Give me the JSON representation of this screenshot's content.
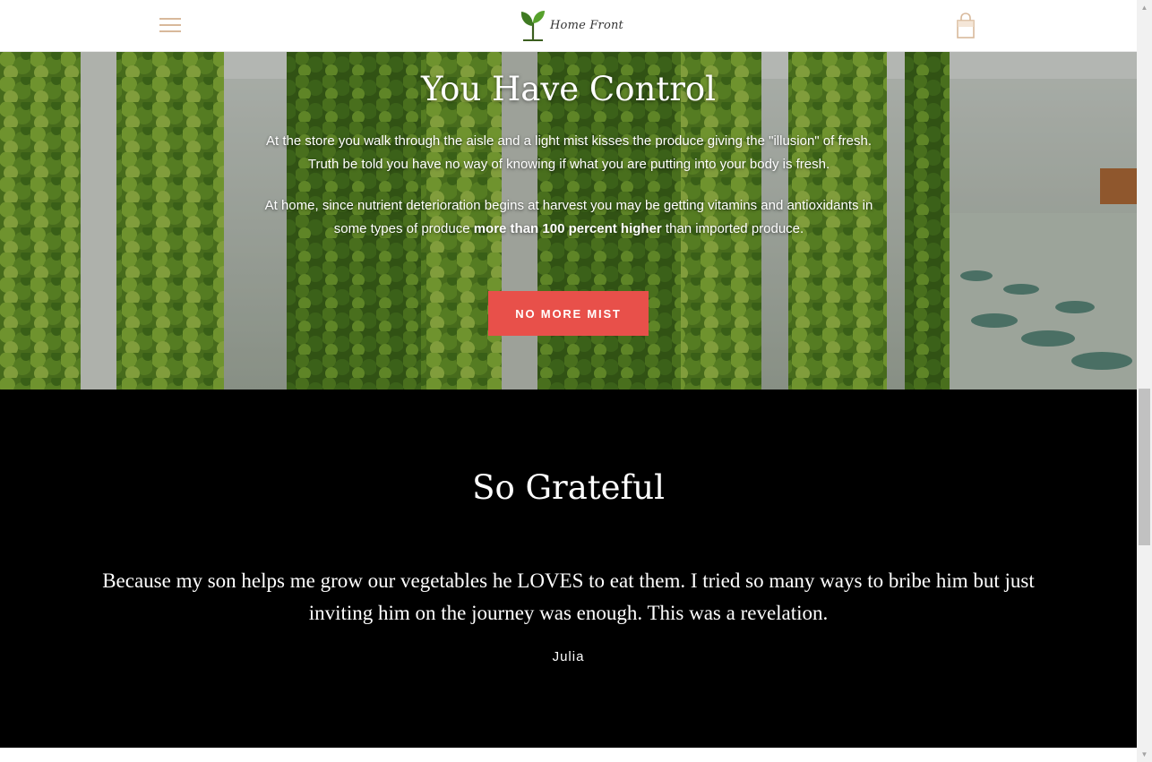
{
  "header": {
    "logo_text": "Home Front",
    "menu_icon": "hamburger-icon",
    "cart_icon": "shopping-bag-icon"
  },
  "hero": {
    "title": "You Have Control",
    "paragraph1": "At the store you walk through the aisle and a light mist kisses the produce giving the \"illusion\" of fresh. Truth be told you have no way of knowing if what you are putting into your body is fresh.",
    "paragraph2_before": "At home, since nutrient deterioration begins at harvest you may be getting vitamins and antioxidants in some types of produce ",
    "paragraph2_bold": "more than 100 percent higher",
    "paragraph2_after": " than imported produce.",
    "button_label": "NO MORE MIST"
  },
  "testimonial": {
    "title": "So Grateful",
    "quote": "Because my son helps me grow our vegetables he LOVES to eat them. I tried so many ways to bribe him but just inviting him on the journey was enough. This was a revelation.",
    "author": "Julia"
  },
  "colors": {
    "accent": "#e8504a",
    "icon": "#d8b99b",
    "testimonial_bg": "#000000"
  }
}
